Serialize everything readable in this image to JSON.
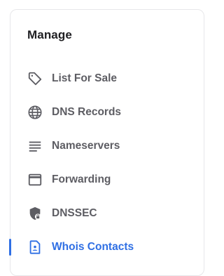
{
  "panel": {
    "title": "Manage"
  },
  "menu": {
    "items": [
      {
        "label": "List For Sale",
        "icon": "tag-icon"
      },
      {
        "label": "DNS Records",
        "icon": "globe-icon"
      },
      {
        "label": "Nameservers",
        "icon": "list-lines-icon"
      },
      {
        "label": "Forwarding",
        "icon": "window-icon"
      },
      {
        "label": "DNSSEC",
        "icon": "shield-lock-icon"
      },
      {
        "label": "Whois Contacts",
        "icon": "contact-card-icon",
        "active": true
      }
    ]
  },
  "colors": {
    "accent": "#2f6fe4",
    "text_default": "#5d5d63",
    "heading": "#1f1f22",
    "border": "#e7e7ea"
  }
}
